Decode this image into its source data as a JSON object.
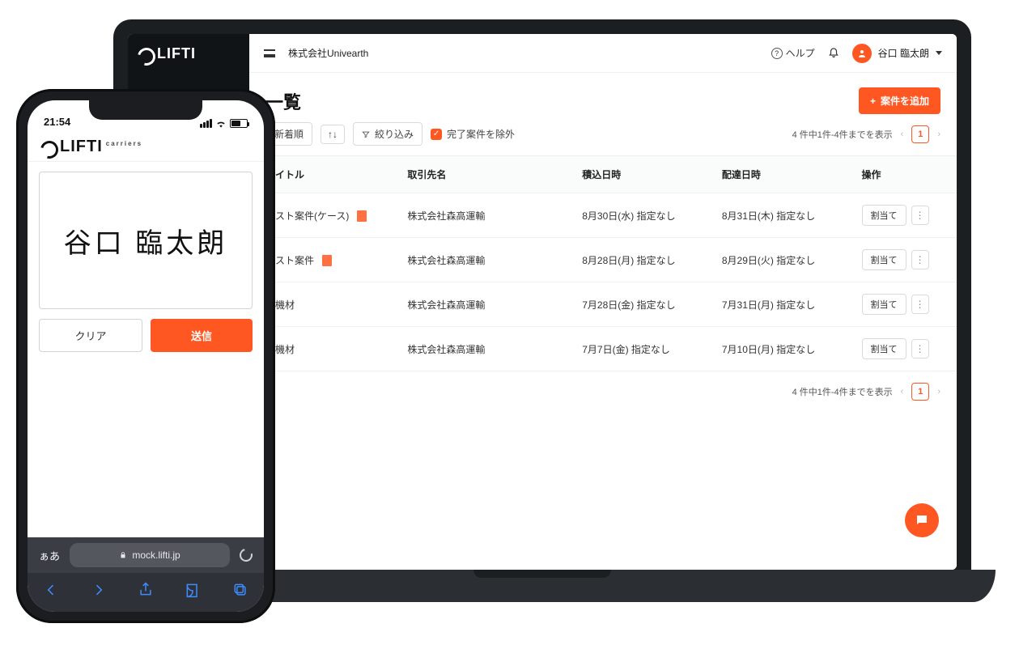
{
  "brand": {
    "name": "LIFTI",
    "sub": "carriers"
  },
  "laptop": {
    "topbar": {
      "company": "株式会社Univearth",
      "help": "ヘルプ",
      "user_name": "谷口 臨太朗"
    },
    "page": {
      "title_suffix": "一覧",
      "add_button": "案件を追加"
    },
    "toolbar": {
      "sort": "新着順",
      "filter": "絞り込み",
      "exclude_done": "完了案件を除外",
      "pager_text": "4 件中1件-4件までを表示",
      "page_current": "1"
    },
    "columns": {
      "title": "タイトル",
      "client": "取引先名",
      "load": "積込日時",
      "deliver": "配達日時",
      "ops": "操作"
    },
    "rows": [
      {
        "title": "テスト案件(ケース)",
        "has_doc": true,
        "client": "株式会社森高運輸",
        "load": "8月30日(水) 指定なし",
        "deliver": "8月31日(木) 指定なし",
        "assign": "割当て"
      },
      {
        "title": "テスト案件",
        "has_doc": true,
        "client": "株式会社森高運輸",
        "load": "8月28日(月) 指定なし",
        "deliver": "8月29日(火) 指定なし",
        "assign": "割当て"
      },
      {
        "title": "プ機材",
        "has_doc": false,
        "client": "株式会社森高運輸",
        "load": "7月28日(金) 指定なし",
        "deliver": "7月31日(月) 指定なし",
        "assign": "割当て"
      },
      {
        "title": "プ機材",
        "has_doc": false,
        "client": "株式会社森高運輸",
        "load": "7月7日(金) 指定なし",
        "deliver": "7月10日(月) 指定なし",
        "assign": "割当て"
      }
    ]
  },
  "phone": {
    "status": {
      "time": "21:54"
    },
    "signature_text": "谷口  臨太朗",
    "clear": "クリア",
    "send": "送信",
    "address": {
      "aa": "ぁあ",
      "url": "mock.lifti.jp"
    }
  },
  "colors": {
    "accent": "#ff5722"
  }
}
